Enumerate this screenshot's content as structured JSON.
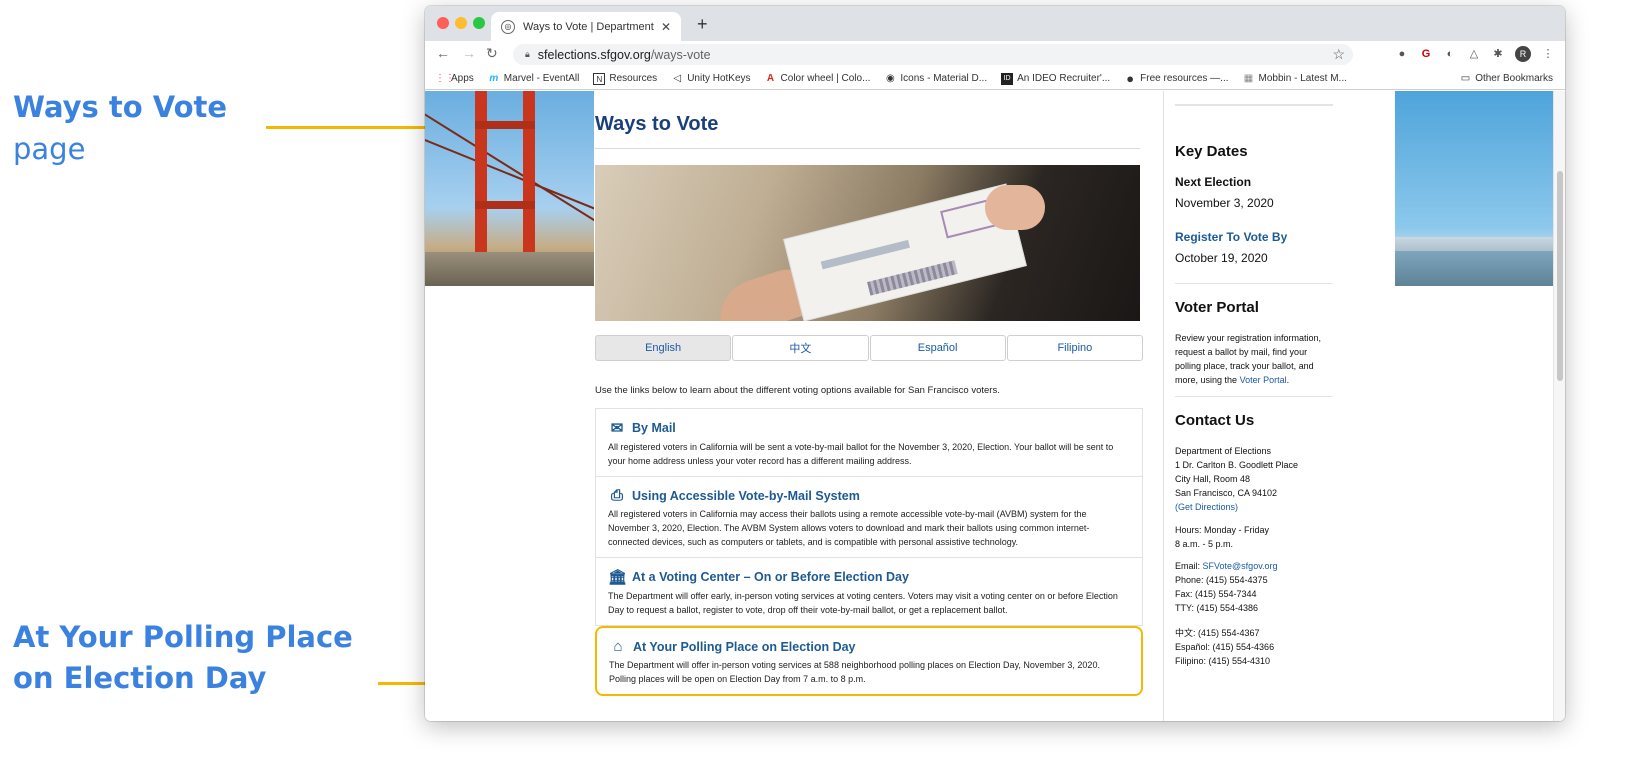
{
  "annotations": {
    "ways_title": "Ways to Vote",
    "ways_sub": "page",
    "polling_line1": "At Your Polling Place",
    "polling_line2": "on Election Day"
  },
  "browser": {
    "tab_title": "Ways to Vote | Department of",
    "url_domain": "sfelections.sfgov.org",
    "url_path": "/ways-vote",
    "bookmarks": [
      {
        "label": "Apps",
        "icon": "apps-grid-icon"
      },
      {
        "label": "Marvel - EventAll",
        "icon": "marvel-icon"
      },
      {
        "label": "Resources",
        "icon": "notion-icon"
      },
      {
        "label": "Unity HotKeys",
        "icon": "unity-icon"
      },
      {
        "label": "Color wheel | Colo...",
        "icon": "adobe-icon"
      },
      {
        "label": "Icons - Material D...",
        "icon": "github-icon"
      },
      {
        "label": "An IDEO Recruiter'...",
        "icon": "ideo-icon"
      },
      {
        "label": "Free resources —...",
        "icon": "circle-icon"
      },
      {
        "label": "Mobbin - Latest M...",
        "icon": "mobbin-icon"
      }
    ],
    "other_bookmarks": "Other Bookmarks",
    "avatar_initial": "R"
  },
  "page": {
    "title": "Ways to Vote",
    "lang_tabs": [
      "English",
      "中文",
      "Español",
      "Filipino"
    ],
    "intro": "Use the links below to learn about the different voting options available for San Francisco voters.",
    "options": [
      {
        "title": "By Mail",
        "icon": "envelope-icon",
        "desc": "All registered voters in California will be sent a vote-by-mail ballot for the November 3, 2020, Election. Your ballot will be sent to your home address unless your voter record has a different mailing address."
      },
      {
        "title": "Using Accessible Vote-by-Mail System",
        "icon": "printer-icon",
        "desc": "All registered voters in California may access their ballots using a remote accessible vote-by-mail (AVBM) system for the November 3, 2020, Election. The AVBM System allows voters to download and mark their ballots using common internet-connected devices, such as computers or tablets, and is compatible with personal assistive technology."
      },
      {
        "title": "At a Voting Center – On or Before Election Day",
        "icon": "building-icon",
        "desc": "The Department will offer early, in-person voting services at voting centers. Voters may visit a voting center on or before Election Day to request a ballot, register to vote, drop off their vote-by-mail ballot, or get a replacement ballot."
      },
      {
        "title": "At Your Polling Place on Election Day",
        "icon": "home-icon",
        "desc": "The Department will offer in-person voting services at 588 neighborhood polling places on Election Day, November 3, 2020. Polling places will be open on Election Day from 7 a.m. to 8 p.m."
      }
    ]
  },
  "sidebar": {
    "key_dates_title": "Key Dates",
    "next_election_label": "Next Election",
    "next_election_date": "November 3, 2020",
    "register_label": "Register To Vote By",
    "register_date": "October 19, 2020",
    "voter_portal_title": "Voter Portal",
    "voter_portal_text": "Review your registration information, request a ballot by mail, find your polling place, track your ballot, and more, using the",
    "voter_portal_link": "Voter Portal",
    "contact_title": "Contact Us",
    "address_lines": [
      "Department of Elections",
      "1 Dr. Carlton B. Goodlett Place",
      "City Hall, Room 48",
      "San Francisco, CA 94102"
    ],
    "directions_link": "(Get Directions)",
    "hours_lines": [
      "Hours: Monday - Friday",
      "8 a.m. - 5 p.m."
    ],
    "email_label": "Email:",
    "email": "SFVote@sfgov.org",
    "phone_lines": [
      "Phone: (415) 554-4375",
      "Fax: (415) 554-7344",
      "TTY: (415) 554-4386"
    ],
    "lang_phone_lines": [
      "中文: (415) 554-4367",
      "Español: (415) 554-4366",
      "Filipino: (415) 554-4310"
    ]
  },
  "colors": {
    "accent_yellow": "#f5b800",
    "annotation_blue": "#3b82e0",
    "title_navy": "#1b3f7a",
    "link_blue": "#1d5a93"
  }
}
